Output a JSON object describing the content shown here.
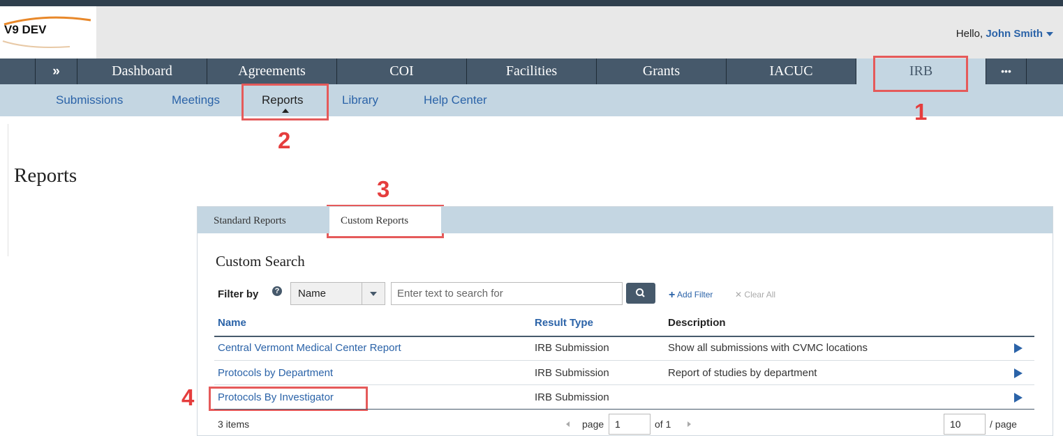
{
  "app": {
    "logo_text": "V9 DEV"
  },
  "header": {
    "greeting": "Hello,",
    "user_name": "John Smith"
  },
  "nav": {
    "expand_symbol": "»",
    "items": [
      "Dashboard",
      "Agreements",
      "COI",
      "Facilities",
      "Grants",
      "IACUC",
      "IRB"
    ],
    "active": "IRB",
    "more_symbol": "•••"
  },
  "subnav": {
    "items": [
      "Submissions",
      "Meetings",
      "Reports",
      "Library",
      "Help Center"
    ],
    "active": "Reports"
  },
  "annotations": [
    "1",
    "2",
    "3",
    "4"
  ],
  "page": {
    "title": "Reports"
  },
  "tabs": {
    "items": [
      "Standard Reports",
      "Custom Reports"
    ],
    "active": "Custom Reports"
  },
  "search": {
    "section_title": "Custom Search",
    "filter_label": "Filter by",
    "help_symbol": "?",
    "field_value": "Name",
    "placeholder": "Enter text to search for",
    "add_filter": "Add Filter",
    "clear_all": "Clear All"
  },
  "table": {
    "columns": [
      "Name",
      "Result Type",
      "Description"
    ],
    "rows": [
      {
        "name": "Central Vermont Medical Center Report",
        "result_type": "IRB Submission",
        "description": "Show all submissions with CVMC locations"
      },
      {
        "name": "Protocols by Department",
        "result_type": "IRB Submission",
        "description": "Report of studies by department"
      },
      {
        "name": "Protocols By Investigator",
        "result_type": "IRB Submission",
        "description": ""
      }
    ]
  },
  "pagination": {
    "item_count": "3 items",
    "page_label": "page",
    "current_page": "1",
    "of_label": "of 1",
    "page_size": "10",
    "per_page_label": "/ page"
  },
  "colors": {
    "accent": "#2b63a8",
    "nav_bg": "#46596b",
    "subnav_bg": "#c4d6e2",
    "annotation": "#e55a5a"
  }
}
